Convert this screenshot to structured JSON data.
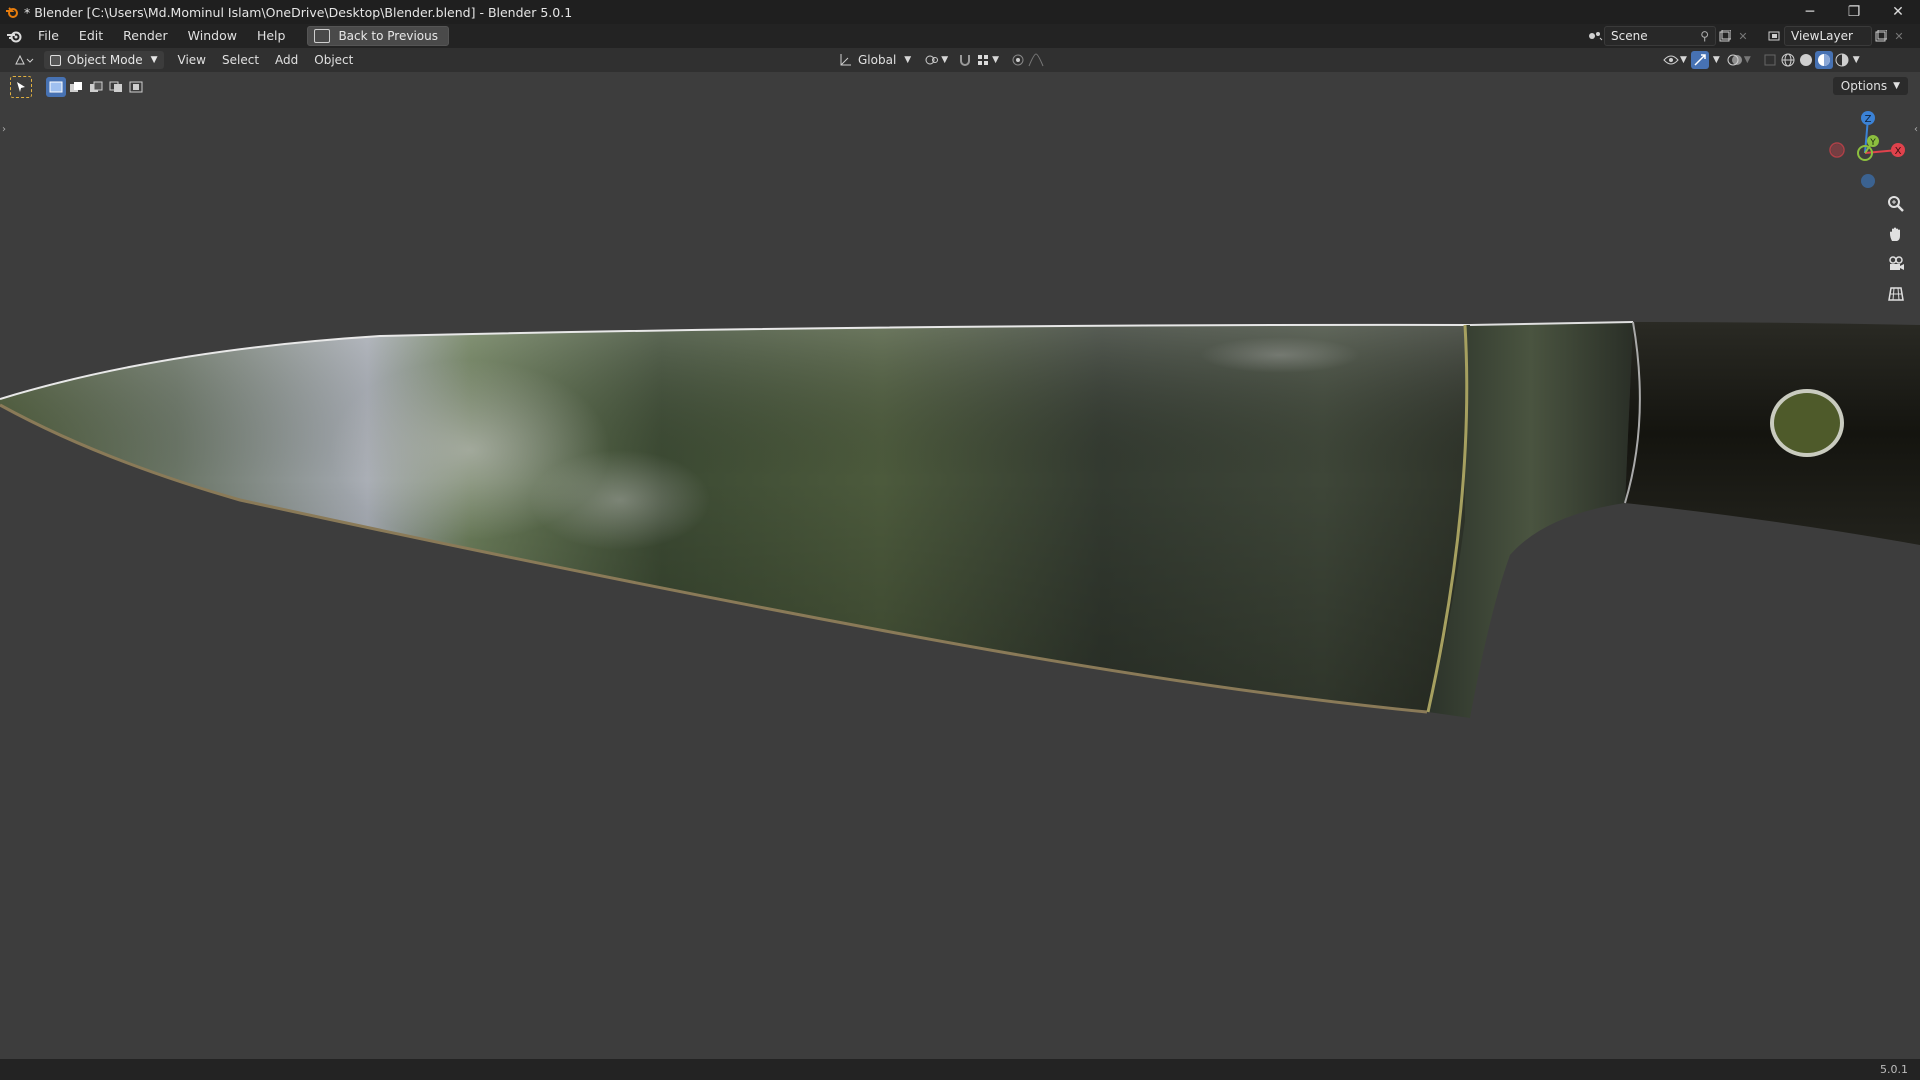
{
  "window": {
    "title": "* Blender [C:\\Users\\Md.Mominul Islam\\OneDrive\\Desktop\\Blender.blend] - Blender 5.0.1",
    "controls": [
      "─",
      "❐",
      "✕"
    ]
  },
  "menubar": {
    "items": [
      "File",
      "Edit",
      "Render",
      "Window",
      "Help"
    ],
    "back_label": "Back to Previous",
    "scene_label": "Scene",
    "viewlayer_label": "ViewLayer"
  },
  "viewport_header": {
    "mode": "Object Mode",
    "menus": [
      "View",
      "Select",
      "Add",
      "Object"
    ],
    "transform_orientation": "Global",
    "options_label": "Options"
  },
  "gizmo": {
    "z": "Z",
    "y": "Y",
    "x": "X"
  },
  "status": {
    "version": "5.0.1"
  },
  "colors": {
    "accent": "#4772b3",
    "axis_x": "#e0424c",
    "axis_y": "#8cbf3f",
    "axis_z": "#3b82d6"
  }
}
